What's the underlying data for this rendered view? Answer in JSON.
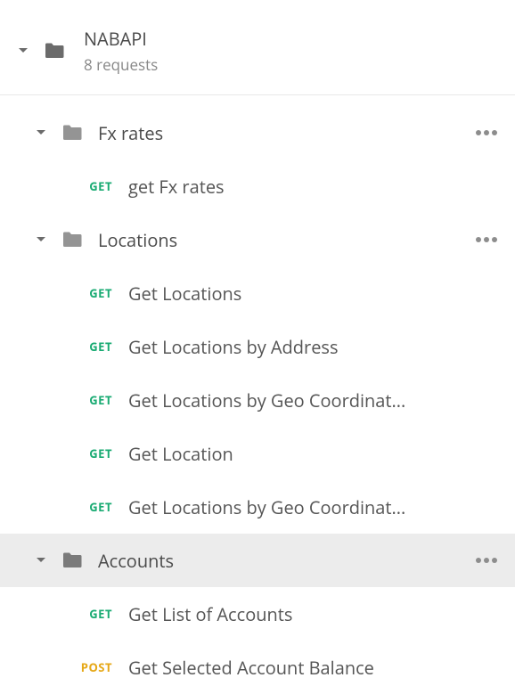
{
  "collection": {
    "name": "NABAPI",
    "subtitle": "8 requests"
  },
  "methods": {
    "get": "GET",
    "post": "POST"
  },
  "folders": [
    {
      "name": "Fx rates",
      "selected": false,
      "requests": [
        {
          "method": "get",
          "name": "get Fx rates"
        }
      ]
    },
    {
      "name": "Locations",
      "selected": false,
      "requests": [
        {
          "method": "get",
          "name": "Get Locations"
        },
        {
          "method": "get",
          "name": "Get Locations by Address"
        },
        {
          "method": "get",
          "name": "Get Locations by Geo Coordinat..."
        },
        {
          "method": "get",
          "name": "Get Location"
        },
        {
          "method": "get",
          "name": "Get Locations by Geo Coordinat..."
        }
      ]
    },
    {
      "name": "Accounts",
      "selected": true,
      "requests": [
        {
          "method": "get",
          "name": "Get List of Accounts"
        },
        {
          "method": "post",
          "name": "Get Selected Account Balance"
        }
      ]
    }
  ]
}
